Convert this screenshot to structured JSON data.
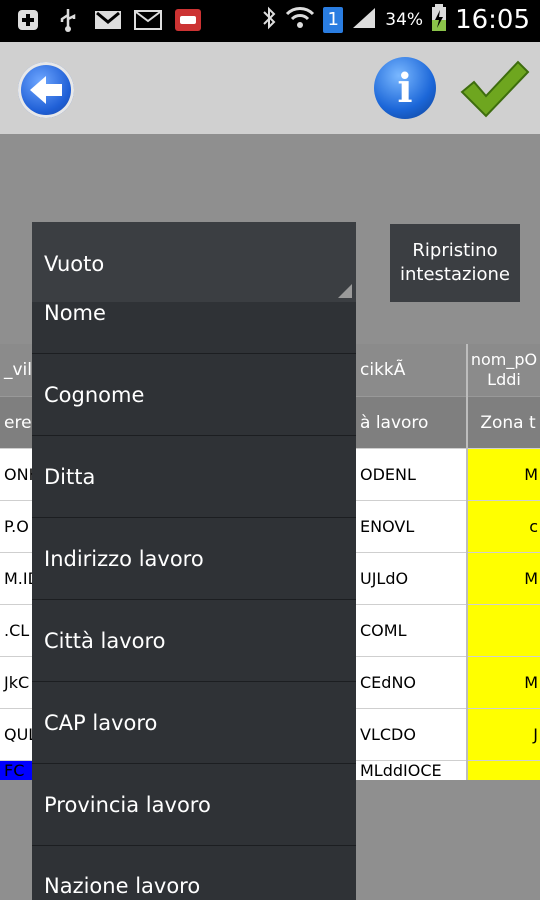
{
  "status_bar": {
    "icons": [
      "plus-icon",
      "usb-icon",
      "gmail-icon",
      "mail-icon",
      "car-icon",
      "bluetooth-icon",
      "wifi-icon",
      "notification-badge-icon",
      "signal-icon",
      "battery-charging-icon"
    ],
    "notification_count": "1",
    "battery_percent": "34%",
    "time": "16:05"
  },
  "toolbar": {
    "back_icon": "back-arrow-icon",
    "info_label": "i",
    "confirm_icon": "checkmark-icon"
  },
  "combo": {
    "selected": "Vuoto"
  },
  "reset_button": {
    "line1": "Ripristino",
    "line2": "intestazione"
  },
  "dropdown": {
    "items": [
      "Nome",
      "Cognome",
      "Ditta",
      "Indirizzo lavoro",
      "Città lavoro",
      "CAP lavoro",
      "Provincia lavoro",
      "Nazione lavoro"
    ]
  },
  "grid": {
    "left_col": {
      "head1": "_vil",
      "head2": "ereç",
      "cells": [
        "ONK",
        "P.O",
        "M.ID",
        ".CL",
        "JkC",
        "QUL",
        "FC"
      ]
    },
    "mid_col": {
      "head1": "cikkÃ",
      "head2": "à lavoro",
      "cells": [
        "ODENL",
        "ENOVL",
        "UJLdO",
        "COML",
        "CEdNO",
        "VLCDO",
        "MLddIOCE"
      ]
    },
    "right_col": {
      "head1a": "nom_pO",
      "head1b": "Lddi",
      "head2": "Zona t",
      "cells": [
        "M",
        "c",
        "M",
        "",
        "M",
        "J",
        ""
      ]
    }
  },
  "colors": {
    "highlight_yellow": "#ffff00",
    "highlight_blue": "#0000ff",
    "dropdown_bg": "#2f3236",
    "toolbar_bg": "#d0d0d0"
  }
}
